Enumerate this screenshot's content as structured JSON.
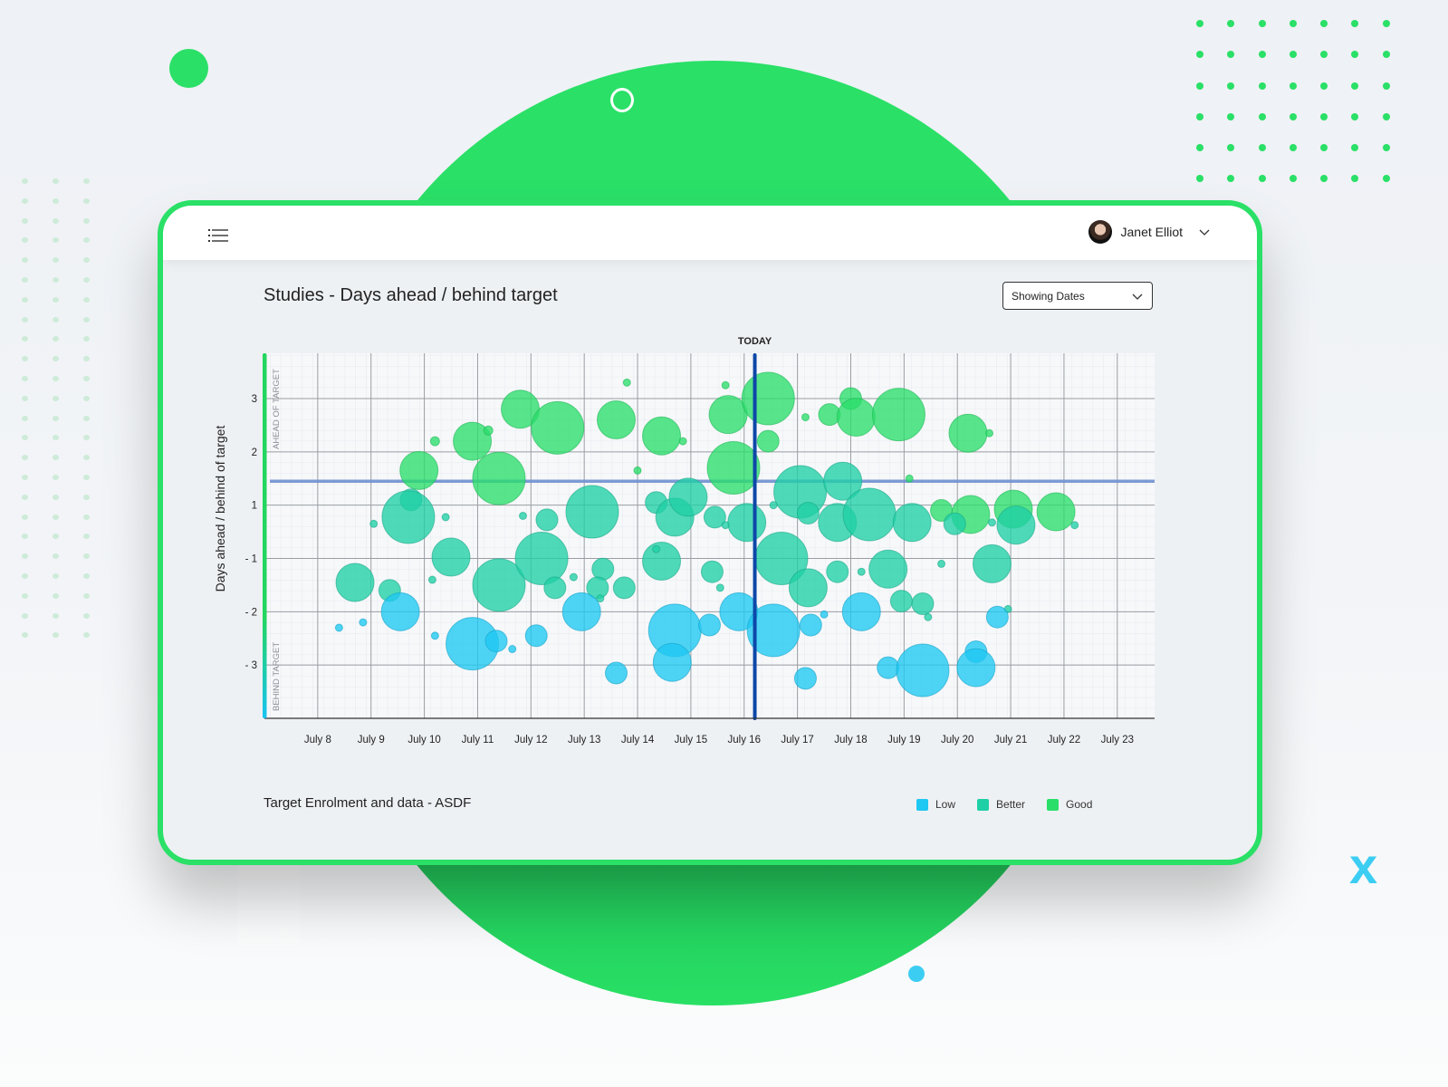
{
  "header": {
    "menu_icon": "list-menu-icon",
    "user_name": "Janet Elliot",
    "avatar_icon": "user-avatar",
    "user_menu_icon": "chevron-down-icon"
  },
  "page": {
    "title": "Studies - Days ahead / behind target",
    "dropdown": {
      "selected": "Showing Dates",
      "icon": "chevron-down-icon"
    },
    "footer_title": "Target Enrolment and data - ASDF"
  },
  "decorations": {
    "corner_mark": "x"
  },
  "colors": {
    "brand_green": "#2ae067",
    "low": "#1ec8f2",
    "better": "#1fcfa5",
    "good": "#2ade6a",
    "target_line": "#6f8fd0",
    "today_line": "#0d47a8",
    "axis_gradient_top": "#22d65f",
    "axis_gradient_bottom": "#18c3f0"
  },
  "chart_data": {
    "type": "scatter",
    "subtype": "bubble",
    "title": "Studies - Days ahead / behind target",
    "xlabel": "",
    "ylabel": "Days ahead / behind of target",
    "x_tick_labels": [
      "July 8",
      "July 9",
      "July 10",
      "July 11",
      "July 12",
      "July 13",
      "July 14",
      "July 15",
      "July 16",
      "July 17",
      "July 18",
      "July 19",
      "July 20",
      "July 21",
      "July 22",
      "July 23"
    ],
    "x_ticks": [
      8,
      9,
      10,
      11,
      12,
      13,
      14,
      15,
      16,
      17,
      18,
      19,
      20,
      21,
      22,
      23
    ],
    "xlim": [
      7,
      23.7
    ],
    "y_tick_labels": [
      "3",
      "2",
      "1",
      "- 1",
      "- 2",
      "- 3"
    ],
    "y_ticks": [
      3,
      2,
      1,
      -1,
      -2,
      -3
    ],
    "ylim": [
      -4,
      3.85
    ],
    "y_axis_note": "axis skips 0; 1 and -1 are one gridline apart",
    "region_labels": {
      "top": "AHEAD OF TARGET",
      "bottom": "BEHIND TARGET"
    },
    "target_line_y": 1.45,
    "today": {
      "label": "TODAY",
      "x": 16.2
    },
    "grid": true,
    "legend": {
      "placement": "bottom-right",
      "entries": [
        {
          "name": "Low",
          "color_key": "low"
        },
        {
          "name": "Better",
          "color_key": "better"
        },
        {
          "name": "Good",
          "color_key": "good"
        }
      ]
    },
    "series": [
      {
        "name": "Good",
        "points": [
          {
            "x": 10.9,
            "y": 2.2,
            "size": 21
          },
          {
            "x": 11.2,
            "y": 2.4,
            "size": 5
          },
          {
            "x": 10.2,
            "y": 2.2,
            "size": 5
          },
          {
            "x": 9.9,
            "y": 1.65,
            "size": 21
          },
          {
            "x": 11.4,
            "y": 1.5,
            "size": 29
          },
          {
            "x": 11.8,
            "y": 2.8,
            "size": 21
          },
          {
            "x": 12.5,
            "y": 2.45,
            "size": 29
          },
          {
            "x": 13.6,
            "y": 2.6,
            "size": 21
          },
          {
            "x": 13.8,
            "y": 3.3,
            "size": 4
          },
          {
            "x": 14.45,
            "y": 2.3,
            "size": 21
          },
          {
            "x": 14.0,
            "y": 1.65,
            "size": 4
          },
          {
            "x": 14.85,
            "y": 2.2,
            "size": 4
          },
          {
            "x": 15.7,
            "y": 2.7,
            "size": 21
          },
          {
            "x": 15.8,
            "y": 1.7,
            "size": 29
          },
          {
            "x": 15.65,
            "y": 3.25,
            "size": 4
          },
          {
            "x": 16.45,
            "y": 3.0,
            "size": 29
          },
          {
            "x": 16.45,
            "y": 2.2,
            "size": 12
          },
          {
            "x": 17.15,
            "y": 2.65,
            "size": 4
          },
          {
            "x": 17.6,
            "y": 2.7,
            "size": 12
          },
          {
            "x": 18.0,
            "y": 3.0,
            "size": 12
          },
          {
            "x": 18.1,
            "y": 2.65,
            "size": 21
          },
          {
            "x": 18.9,
            "y": 2.7,
            "size": 29
          },
          {
            "x": 19.1,
            "y": 1.5,
            "size": 4
          },
          {
            "x": 19.7,
            "y": 0.8,
            "size": 12
          },
          {
            "x": 20.2,
            "y": 2.35,
            "size": 21
          },
          {
            "x": 20.6,
            "y": 2.35,
            "size": 4
          },
          {
            "x": 20.25,
            "y": 0.65,
            "size": 21
          },
          {
            "x": 21.05,
            "y": 0.85,
            "size": 21
          },
          {
            "x": 21.85,
            "y": 0.75,
            "size": 21
          }
        ]
      },
      {
        "name": "Better",
        "points": [
          {
            "x": 9.75,
            "y": 1.1,
            "size": 12
          },
          {
            "x": 9.7,
            "y": 0.55,
            "size": 29
          },
          {
            "x": 9.05,
            "y": 0.3,
            "size": 4
          },
          {
            "x": 8.7,
            "y": -1.45,
            "size": 21
          },
          {
            "x": 9.35,
            "y": -1.6,
            "size": 12
          },
          {
            "x": 10.15,
            "y": -1.4,
            "size": 4
          },
          {
            "x": 10.5,
            "y": -0.95,
            "size": 21
          },
          {
            "x": 10.4,
            "y": 0.55,
            "size": 4
          },
          {
            "x": 11.4,
            "y": -1.5,
            "size": 29
          },
          {
            "x": 11.85,
            "y": 0.6,
            "size": 4
          },
          {
            "x": 12.3,
            "y": 0.45,
            "size": 12
          },
          {
            "x": 12.2,
            "y": -1.0,
            "size": 29
          },
          {
            "x": 12.45,
            "y": -1.55,
            "size": 12
          },
          {
            "x": 12.8,
            "y": -1.35,
            "size": 4
          },
          {
            "x": 13.15,
            "y": 0.75,
            "size": 29
          },
          {
            "x": 13.35,
            "y": -1.2,
            "size": 12
          },
          {
            "x": 13.25,
            "y": -1.55,
            "size": 12
          },
          {
            "x": 13.3,
            "y": -1.75,
            "size": 4
          },
          {
            "x": 13.75,
            "y": -1.55,
            "size": 12
          },
          {
            "x": 14.35,
            "y": 1.05,
            "size": 12
          },
          {
            "x": 14.7,
            "y": 0.55,
            "size": 21
          },
          {
            "x": 14.95,
            "y": 1.15,
            "size": 21
          },
          {
            "x": 14.45,
            "y": -1.05,
            "size": 21
          },
          {
            "x": 14.35,
            "y": -0.65,
            "size": 4
          },
          {
            "x": 15.45,
            "y": 0.55,
            "size": 12
          },
          {
            "x": 15.4,
            "y": -1.25,
            "size": 12
          },
          {
            "x": 15.55,
            "y": -1.55,
            "size": 4
          },
          {
            "x": 16.05,
            "y": 0.35,
            "size": 21
          },
          {
            "x": 15.65,
            "y": 0.25,
            "size": 4
          },
          {
            "x": 16.7,
            "y": -1.0,
            "size": 29
          },
          {
            "x": 17.05,
            "y": 1.25,
            "size": 29
          },
          {
            "x": 16.55,
            "y": 1.0,
            "size": 4
          },
          {
            "x": 17.2,
            "y": 0.7,
            "size": 12
          },
          {
            "x": 17.2,
            "y": -1.55,
            "size": 21
          },
          {
            "x": 17.85,
            "y": 1.45,
            "size": 21
          },
          {
            "x": 17.75,
            "y": 0.35,
            "size": 21
          },
          {
            "x": 17.75,
            "y": -1.25,
            "size": 12
          },
          {
            "x": 18.2,
            "y": -1.25,
            "size": 4
          },
          {
            "x": 18.35,
            "y": 0.65,
            "size": 29
          },
          {
            "x": 18.7,
            "y": -1.2,
            "size": 21
          },
          {
            "x": 19.15,
            "y": 0.35,
            "size": 21
          },
          {
            "x": 18.95,
            "y": -1.8,
            "size": 12
          },
          {
            "x": 19.35,
            "y": -1.85,
            "size": 12
          },
          {
            "x": 19.45,
            "y": -2.1,
            "size": 4
          },
          {
            "x": 19.7,
            "y": -1.1,
            "size": 4
          },
          {
            "x": 19.95,
            "y": 0.3,
            "size": 12
          },
          {
            "x": 20.65,
            "y": 0.35,
            "size": 4
          },
          {
            "x": 20.65,
            "y": -1.1,
            "size": 21
          },
          {
            "x": 21.1,
            "y": 0.25,
            "size": 21
          },
          {
            "x": 20.95,
            "y": -1.95,
            "size": 4
          },
          {
            "x": 22.2,
            "y": 0.25,
            "size": 4
          }
        ]
      },
      {
        "name": "Low",
        "points": [
          {
            "x": 8.4,
            "y": -2.3,
            "size": 4
          },
          {
            "x": 8.85,
            "y": -2.2,
            "size": 4
          },
          {
            "x": 9.55,
            "y": -2.0,
            "size": 21
          },
          {
            "x": 10.2,
            "y": -2.45,
            "size": 4
          },
          {
            "x": 10.9,
            "y": -2.6,
            "size": 29
          },
          {
            "x": 11.35,
            "y": -2.55,
            "size": 12
          },
          {
            "x": 11.65,
            "y": -2.7,
            "size": 4
          },
          {
            "x": 12.1,
            "y": -2.45,
            "size": 12
          },
          {
            "x": 12.95,
            "y": -2.0,
            "size": 21
          },
          {
            "x": 13.6,
            "y": -3.15,
            "size": 12
          },
          {
            "x": 14.7,
            "y": -2.35,
            "size": 29
          },
          {
            "x": 14.65,
            "y": -2.95,
            "size": 21
          },
          {
            "x": 15.35,
            "y": -2.25,
            "size": 12
          },
          {
            "x": 15.9,
            "y": -2.0,
            "size": 21
          },
          {
            "x": 16.55,
            "y": -2.35,
            "size": 29
          },
          {
            "x": 17.25,
            "y": -2.25,
            "size": 12
          },
          {
            "x": 17.15,
            "y": -3.25,
            "size": 12
          },
          {
            "x": 17.5,
            "y": -2.05,
            "size": 4
          },
          {
            "x": 18.2,
            "y": -2.0,
            "size": 21
          },
          {
            "x": 18.7,
            "y": -3.05,
            "size": 12
          },
          {
            "x": 19.35,
            "y": -3.1,
            "size": 29
          },
          {
            "x": 20.35,
            "y": -2.75,
            "size": 12
          },
          {
            "x": 20.35,
            "y": -3.05,
            "size": 21
          },
          {
            "x": 20.75,
            "y": -2.1,
            "size": 12
          }
        ]
      }
    ]
  }
}
